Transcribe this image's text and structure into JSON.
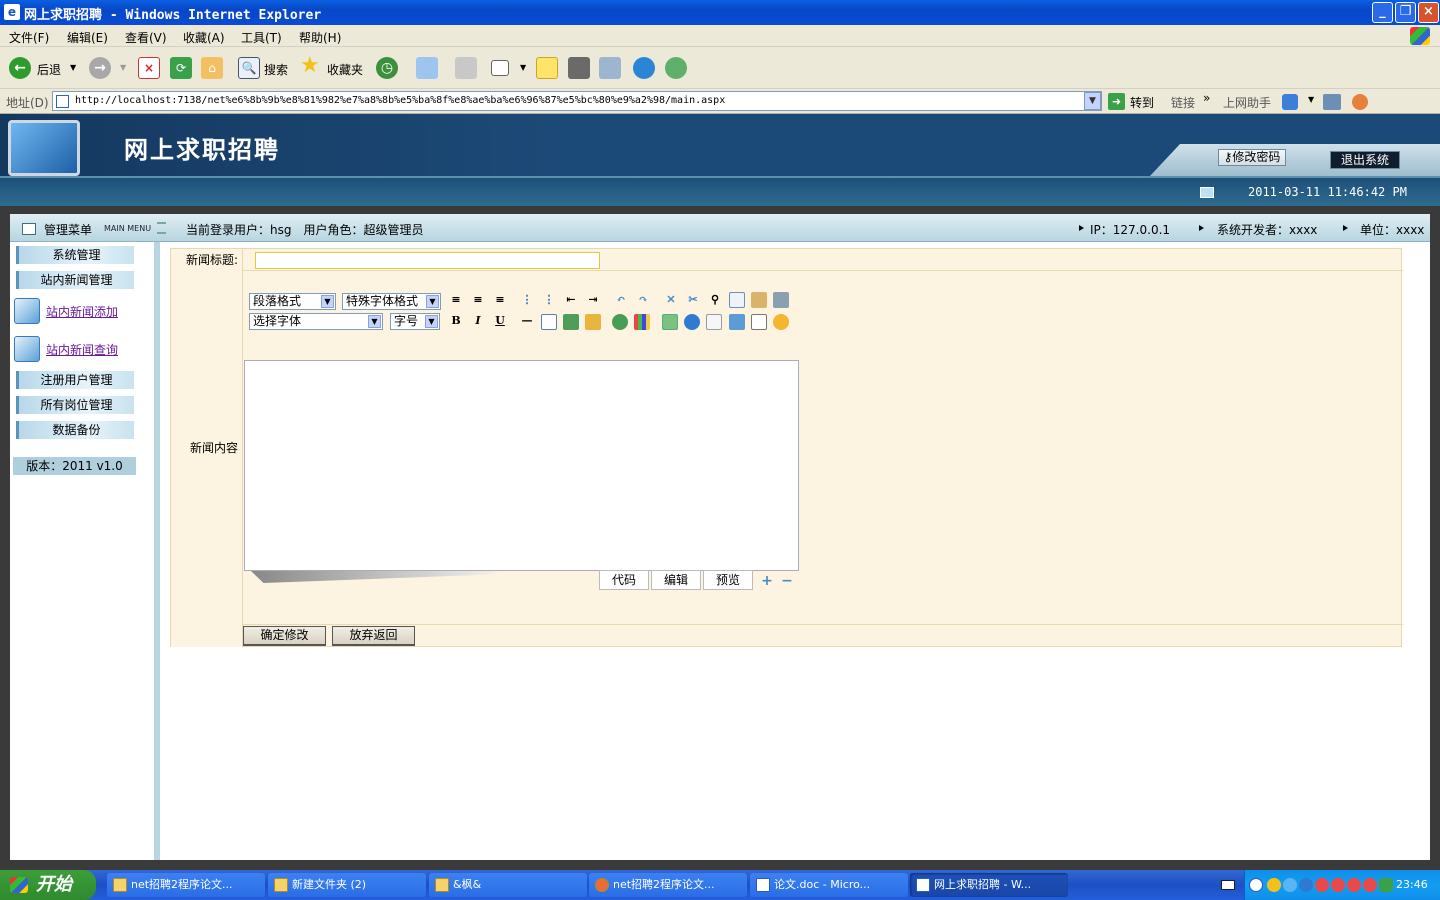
{
  "window": {
    "title": "网上求职招聘 - Windows Internet Explorer",
    "buttons": [
      "_",
      "❐",
      "×"
    ]
  },
  "menubar": [
    "文件(F)",
    "编辑(E)",
    "查看(V)",
    "收藏(A)",
    "工具(T)",
    "帮助(H)"
  ],
  "toolbar": {
    "back": "后退",
    "search": "搜索",
    "favorites": "收藏夹"
  },
  "address": {
    "label": "地址(D)",
    "url": "http://localhost:7138/net%e6%8b%9b%e8%81%982%e7%a8%8b%e5%ba%8f%e8%ae%ba%e6%96%87%e5%bc%80%e9%a2%98/main.aspx",
    "go": "转到",
    "links": "链接",
    "more": "»",
    "helper": "上网助手"
  },
  "site": {
    "title": "网上求职招聘",
    "change_password": "修改密码",
    "logout": "退出系统",
    "datetime": "2011-03-11 11:46:42 PM"
  },
  "infobar": {
    "menu_title": "管理菜单",
    "menu_title_en": "MAIN MENU",
    "current_user": "当前登录用户：hsg　用户角色：超级管理员",
    "ip": "IP：127.0.0.1",
    "developer": "系统开发者：xxxx",
    "unit": "单位：xxxx"
  },
  "sidebar": {
    "items": [
      "系统管理",
      "站内新闻管理",
      "注册用户管理",
      "所有岗位管理",
      "数据备份"
    ],
    "links": [
      "站内新闻添加",
      "站内新闻查询"
    ],
    "version": "版本：2011  v1.0"
  },
  "form": {
    "title_label": "新闻标题:",
    "title_value": "",
    "content_label": "新闻内容",
    "editor": {
      "paragraph_format": "段落格式",
      "special_format": "特殊字体格式",
      "font_select": "选择字体",
      "font_size": "字号",
      "bold": "B",
      "italic": "I",
      "underline": "U",
      "tabs": [
        "代码",
        "编辑",
        "预览"
      ]
    },
    "submit": "确定修改",
    "cancel": "放弃返回"
  },
  "taskbar": {
    "start": "开始",
    "tasks": [
      "net招聘2程序论文...",
      "新建文件夹 (2)",
      "&枫&",
      "net招聘2程序论文...",
      "论文.doc - Micro...",
      "网上求职招聘 - W..."
    ],
    "clock": "23:46"
  },
  "colors": {
    "banner": "#1c4a78",
    "form_bg": "#fcf3e0",
    "sidebar_accent": "#b9d5e1",
    "link": "#6a1a99",
    "taskbar": "#245edb"
  }
}
